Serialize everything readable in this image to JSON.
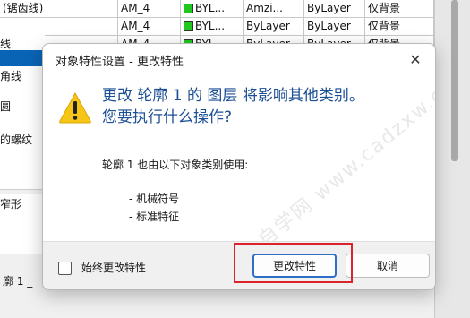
{
  "background_table": {
    "rows": [
      {
        "name": "(锯齿线)",
        "layer": "AM_4",
        "color": "BYL...",
        "linetype": "Amzi...",
        "lineweight": "ByLayer",
        "plot": "仅背景"
      },
      {
        "name": "",
        "layer": "AM_4",
        "color": "BYL...",
        "linetype": "ByLayer",
        "lineweight": "ByLayer",
        "plot": "仅背景"
      },
      {
        "name": "",
        "layer": "AM_4",
        "color": "BYL...",
        "linetype": "ByLayer",
        "lineweight": "ByLayer",
        "plot": "仅背景"
      }
    ],
    "left_items": [
      "线",
      "角线",
      "圆",
      "的螺纹",
      "窄形"
    ],
    "bottom_left": "廓 1 _"
  },
  "dialog": {
    "title": "对象特性设置 - 更改特性",
    "close_glyph": "✕",
    "main_message_line1": "更改 轮廓 1 的 图层 将影响其他类别。",
    "main_message_line2": "您要执行什么操作?",
    "sub_message": "轮廓 1 也由以下对象类别使用:",
    "categories": [
      "- 机械符号",
      "- 标准特征"
    ],
    "checkbox_label": "始终更改特性",
    "checkbox_checked": false,
    "primary_button": "更改特性",
    "cancel_button": "取消",
    "watermark": "CAD自学网 www.cadzxw.com"
  },
  "colors": {
    "message_blue": "#1c4f94",
    "highlight_red": "#d9232d",
    "primary_border": "#2d6fc7",
    "warning_yellow": "#f5c518"
  },
  "icons": {
    "warning": "warning-icon",
    "close": "close-icon"
  }
}
